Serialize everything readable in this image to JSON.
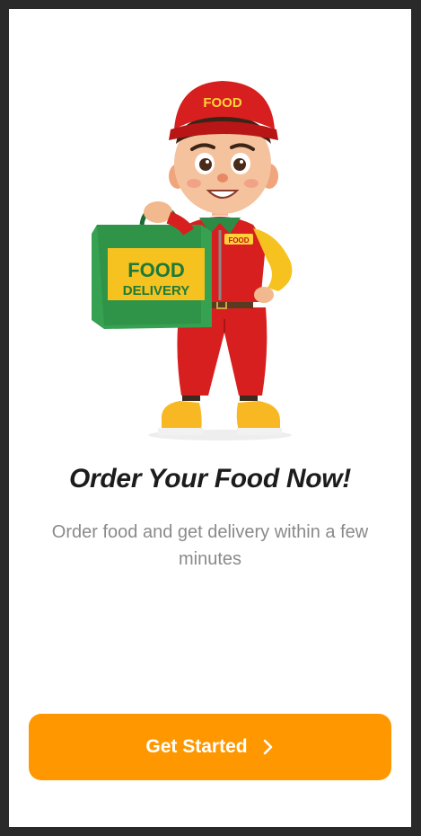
{
  "illustration": {
    "cap_text": "FOOD",
    "chest_tag_text": "FOOD",
    "bag_line1": "FOOD",
    "bag_line2": "DELIVERY"
  },
  "onboarding": {
    "title": "Order Your Food Now!",
    "subtitle": "Order food and get delivery within a few minutes",
    "cta_label": "Get Started",
    "cta_icon": "chevron-right-icon"
  },
  "colors": {
    "accent": "#ff9800",
    "title": "#1c1c1c",
    "subtitle": "#8a8a8a",
    "background": "#ffffff"
  }
}
